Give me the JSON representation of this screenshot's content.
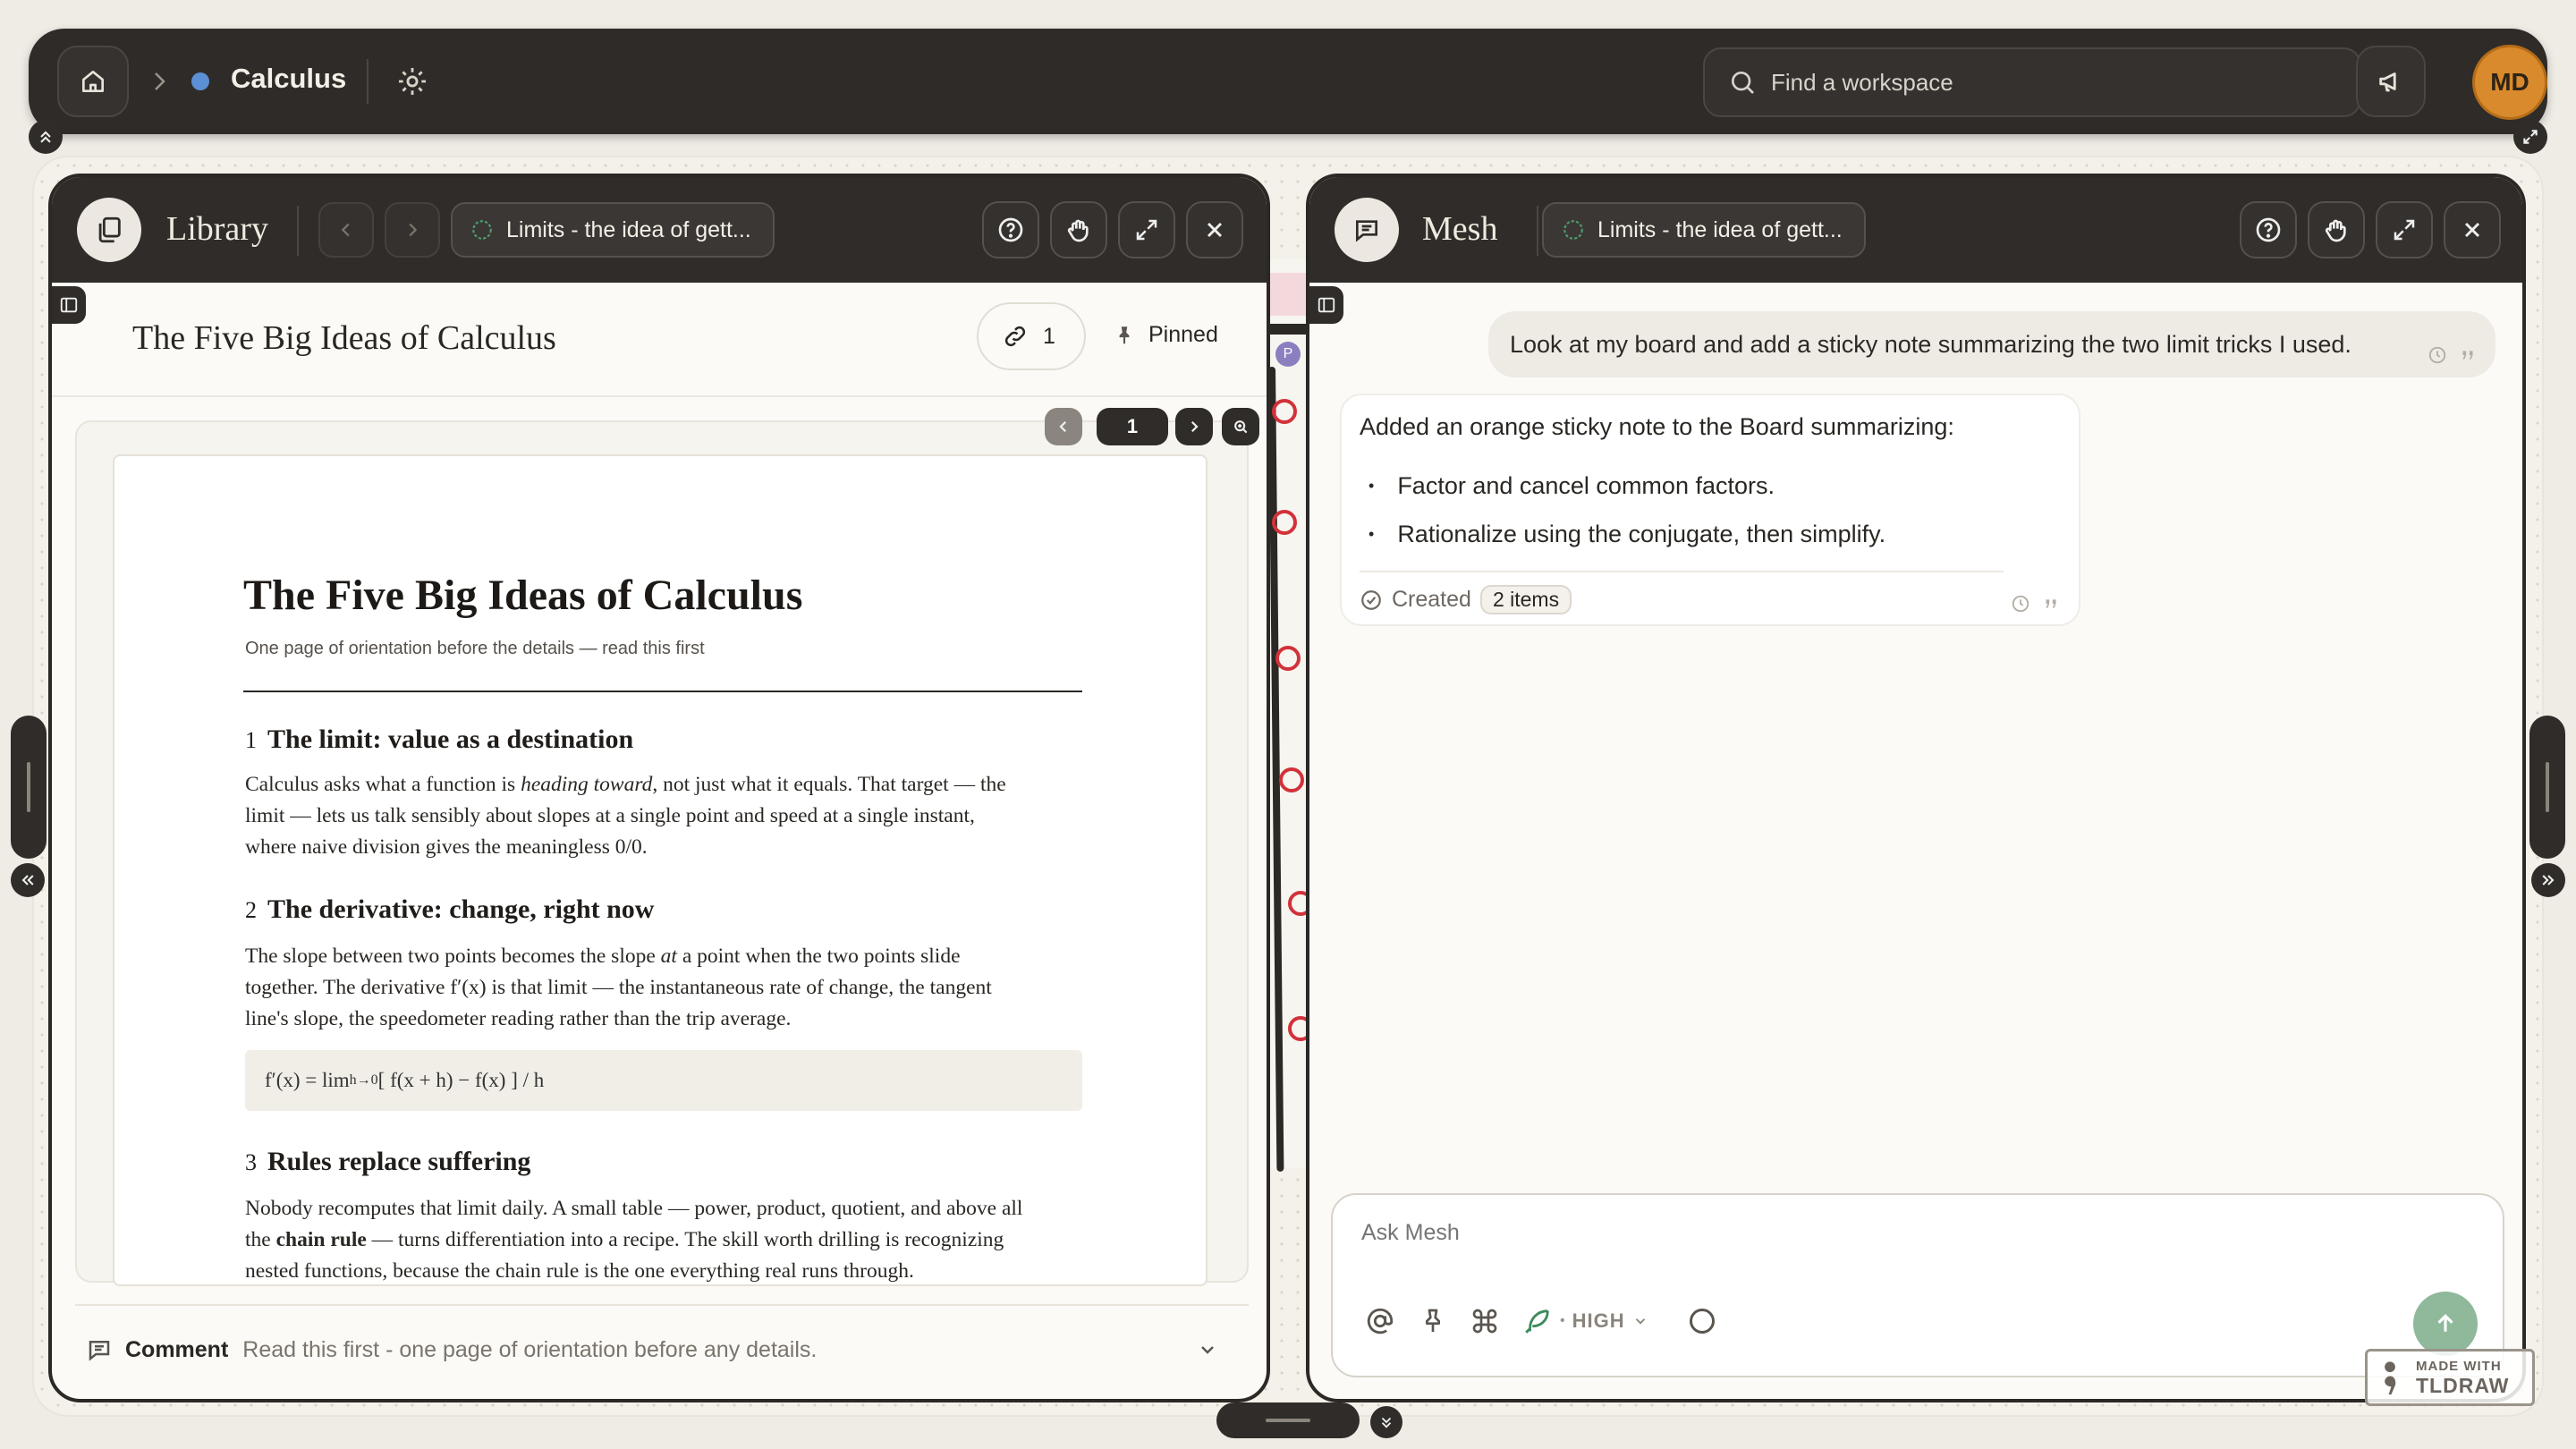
{
  "topbar": {
    "breadcrumb_title": "Calculus",
    "search_placeholder": "Find a workspace",
    "avatar_initials": "MD"
  },
  "library": {
    "title": "Library",
    "tab_chip": "Limits - the idea of gett...",
    "doc_title": "The Five Big Ideas of Calculus",
    "link_count": "1",
    "pinned_label": "Pinned",
    "page_number": "1",
    "doc": {
      "heading": "The Five Big Ideas of Calculus",
      "subtitle": "One page of orientation before the details — read this first",
      "sections": [
        {
          "num": "1",
          "title": "The limit: value as a destination",
          "lines": [
            [
              "Calculus asks what a function is ",
              "heading toward",
              ", not just what it equals. That target — the"
            ],
            [
              "limit — lets us talk sensibly about slopes at a single point and speed at a single instant,"
            ],
            [
              "where naive division gives the meaningless 0/0."
            ]
          ]
        },
        {
          "num": "2",
          "title": "The derivative: change, right now",
          "lines": [
            [
              "The slope between two points becomes the slope ",
              "at",
              " a point when the two points slide"
            ],
            [
              "together. The derivative f′(x) is that limit — the instantaneous rate of change, the tangent"
            ],
            [
              "line's slope, the speedometer reading rather than the trip average."
            ]
          ],
          "formula_main": "f′(x) = lim",
          "formula_sub": "h→0",
          "formula_rest": " [ f(x + h) − f(x) ] / h"
        },
        {
          "num": "3",
          "title": "Rules replace suffering",
          "lines": [
            [
              "Nobody recomputes that limit daily. A small table — power, product, quotient, and above all"
            ],
            [
              "the ",
              "chain rule",
              " — turns differentiation into a recipe. The skill worth drilling is recognizing"
            ],
            [
              "nested functions, because the chain rule is the one everything real runs through."
            ]
          ]
        }
      ]
    },
    "comment_label": "Comment",
    "comment_text": "Read this first - one page of orientation before any details."
  },
  "mesh": {
    "title": "Mesh",
    "tab_chip": "Limits - the idea of gett...",
    "user_message": "Look at my board and add a sticky note summarizing the two limit tricks I used.",
    "ai_intro": "Added an orange sticky note to the Board summarizing:",
    "ai_bullets": [
      "Factor and cancel common factors.",
      "Rationalize using the conjugate, then simplify."
    ],
    "created_label": "Created",
    "created_badge": "2 items",
    "input_placeholder": "Ask Mesh",
    "effort_label": "HIGH"
  },
  "watermark": {
    "line1": "MADE WITH",
    "line2": "TLDRAW"
  },
  "colors": {
    "dark": "#2f2c29",
    "accent_orange": "#d98a2c",
    "ring_red": "#d2323a",
    "send_green": "#8fb99a"
  }
}
